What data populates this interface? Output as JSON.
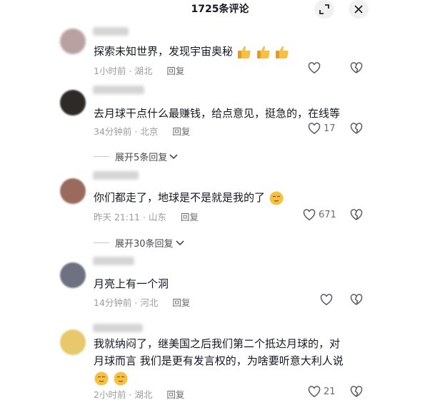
{
  "header": {
    "title": "1725条评论",
    "expand_icon": "expand-icon",
    "close_icon": "close-icon"
  },
  "comments": [
    {
      "text": "探索未知世界，发现宇宙奥秘",
      "emojis": [
        "thumbs-up",
        "thumbs-up",
        "thumbs-up"
      ],
      "time": "1小时前",
      "location": "湖北",
      "reply_label": "回复",
      "likes": ""
    },
    {
      "text": "去月球干点什么最赚钱，给点意见，挺急的，在线等",
      "emojis": [],
      "time": "34分钟前",
      "location": "北京",
      "reply_label": "回复",
      "likes": "17",
      "expand_label": "展开5条回复"
    },
    {
      "text": "你们都走了，地球是不是就是我的了",
      "emojis": [
        "sly-face"
      ],
      "time": "昨天 21:11",
      "location": "山东",
      "reply_label": "回复",
      "likes": "671",
      "expand_label": "展开30条回复"
    },
    {
      "text": "月亮上有一个洞",
      "emojis": [],
      "time": "14分钟前",
      "location": "河北",
      "reply_label": "回复",
      "likes": ""
    },
    {
      "text_line1": "我就纳闷了，继美国之后我们第二个抵达月球的，对",
      "text_line2": "月球而言 我们是更有发言权的，为啥要听意大利人说",
      "emojis": [
        "sly-face",
        "sly-face"
      ],
      "time": "2小时前",
      "location": "湖北",
      "reply_label": "回复",
      "likes": "21"
    }
  ],
  "colors": {
    "text": "#161823",
    "meta": "#9c9ca0",
    "button_bg": "#f1f1f2",
    "emoji_yellow": "#f6c043"
  }
}
